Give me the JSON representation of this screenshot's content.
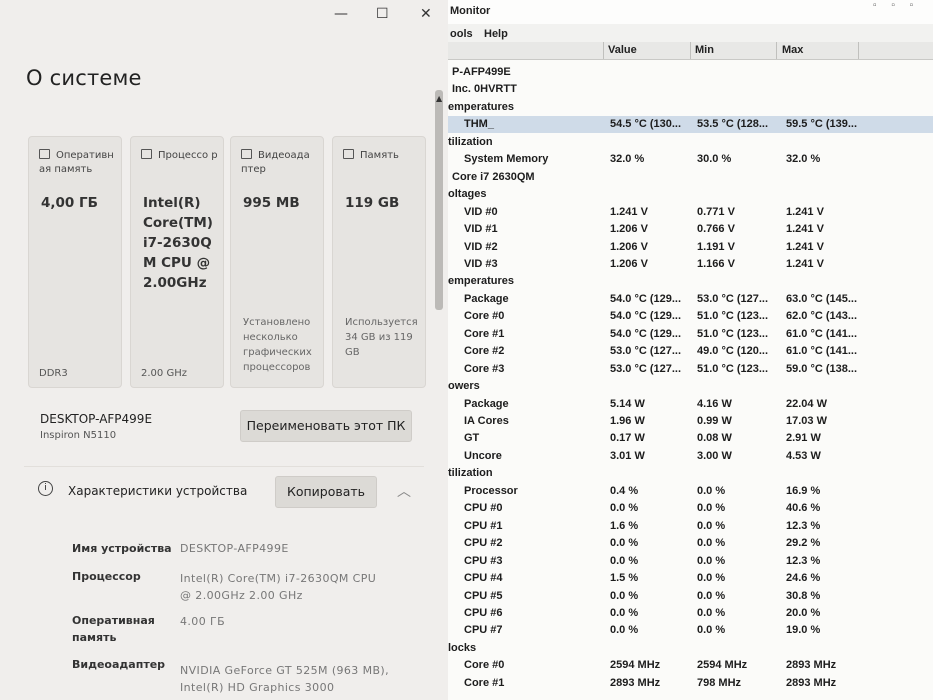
{
  "settings": {
    "window_controls": {
      "minimize": "—",
      "maximize": "☐",
      "close": "✕"
    },
    "title": "О системе",
    "tiles": [
      {
        "icon": "ram-icon",
        "header": "Оперативн ая память",
        "value": "4,00 ГБ",
        "note": "",
        "footer": "DDR3"
      },
      {
        "icon": "cpu-icon",
        "header": "Процессо р",
        "value": "Intel(R) Core(TM) i7-2630Q M CPU @ 2.00GHz",
        "note": "",
        "footer": "2.00 GHz"
      },
      {
        "icon": "gpu-icon",
        "header": "Видеоада птер",
        "value": "995 MB",
        "note": "Установлено несколько графических процессоров",
        "footer": ""
      },
      {
        "icon": "storage-icon",
        "header": "Память",
        "value": "119 GB",
        "note": "Используется 34 GB из 119 GB",
        "footer": ""
      }
    ],
    "device_name": "DESKTOP-AFP499E",
    "device_model": "Inspiron N5110",
    "rename_button": "Переименовать этот ПК",
    "device_specs": {
      "title": "Характеристики устройства",
      "copy_button": "Копировать",
      "rows": [
        {
          "key": "Имя устройства",
          "value": "DESKTOP-AFP499E"
        },
        {
          "key": "Процессор",
          "value": "Intel(R) Core(TM) i7-2630QM CPU @ 2.00GHz   2.00 GHz"
        },
        {
          "key": "Оперативная память",
          "value": "4.00 ГБ"
        },
        {
          "key": "Видеоадаптер",
          "value": "NVIDIA GeForce GT 525M (963 MB), Intel(R) HD Graphics 3000"
        }
      ]
    }
  },
  "hwmonitor": {
    "title": "Monitor",
    "menu": [
      "ools",
      "Help"
    ],
    "columns": [
      "Value",
      "Min",
      "Max"
    ],
    "rows": [
      {
        "kind": "dev",
        "label": "P-AFP499E"
      },
      {
        "kind": "dev",
        "label": "Inc. 0HVRTT"
      },
      {
        "kind": "sec",
        "label": "emperatures"
      },
      {
        "kind": "item",
        "label": "THM_",
        "value": "54.5 °C (130...",
        "min": "53.5 °C (128...",
        "max": "59.5 °C (139...",
        "selected": true
      },
      {
        "kind": "sec",
        "label": "tilization"
      },
      {
        "kind": "item",
        "label": "System Memory",
        "value": "32.0 %",
        "min": "30.0 %",
        "max": "32.0 %"
      },
      {
        "kind": "dev",
        "label": "Core i7 2630QM"
      },
      {
        "kind": "sec",
        "label": "oltages"
      },
      {
        "kind": "item",
        "label": "VID #0",
        "value": "1.241 V",
        "min": "0.771 V",
        "max": "1.241 V"
      },
      {
        "kind": "item",
        "label": "VID #1",
        "value": "1.206 V",
        "min": "0.766 V",
        "max": "1.241 V"
      },
      {
        "kind": "item",
        "label": "VID #2",
        "value": "1.206 V",
        "min": "1.191 V",
        "max": "1.241 V"
      },
      {
        "kind": "item",
        "label": "VID #3",
        "value": "1.206 V",
        "min": "1.166 V",
        "max": "1.241 V"
      },
      {
        "kind": "sec",
        "label": "emperatures"
      },
      {
        "kind": "item",
        "label": "Package",
        "value": "54.0 °C (129...",
        "min": "53.0 °C (127...",
        "max": "63.0 °C (145..."
      },
      {
        "kind": "item",
        "label": "Core #0",
        "value": "54.0 °C (129...",
        "min": "51.0 °C (123...",
        "max": "62.0 °C (143..."
      },
      {
        "kind": "item",
        "label": "Core #1",
        "value": "54.0 °C (129...",
        "min": "51.0 °C (123...",
        "max": "61.0 °C (141..."
      },
      {
        "kind": "item",
        "label": "Core #2",
        "value": "53.0 °C (127...",
        "min": "49.0 °C (120...",
        "max": "61.0 °C (141..."
      },
      {
        "kind": "item",
        "label": "Core #3",
        "value": "53.0 °C (127...",
        "min": "51.0 °C (123...",
        "max": "59.0 °C (138..."
      },
      {
        "kind": "sec",
        "label": "owers"
      },
      {
        "kind": "item",
        "label": "Package",
        "value": "5.14 W",
        "min": "4.16 W",
        "max": "22.04 W"
      },
      {
        "kind": "item",
        "label": "IA Cores",
        "value": "1.96 W",
        "min": "0.99 W",
        "max": "17.03 W"
      },
      {
        "kind": "item",
        "label": "GT",
        "value": "0.17 W",
        "min": "0.08 W",
        "max": "2.91 W"
      },
      {
        "kind": "item",
        "label": "Uncore",
        "value": "3.01 W",
        "min": "3.00 W",
        "max": "4.53 W"
      },
      {
        "kind": "sec",
        "label": "tilization"
      },
      {
        "kind": "item",
        "label": "Processor",
        "value": "0.4 %",
        "min": "0.0 %",
        "max": "16.9 %"
      },
      {
        "kind": "item",
        "label": "CPU #0",
        "value": "0.0 %",
        "min": "0.0 %",
        "max": "40.6 %"
      },
      {
        "kind": "item",
        "label": "CPU #1",
        "value": "1.6 %",
        "min": "0.0 %",
        "max": "12.3 %"
      },
      {
        "kind": "item",
        "label": "CPU #2",
        "value": "0.0 %",
        "min": "0.0 %",
        "max": "29.2 %"
      },
      {
        "kind": "item",
        "label": "CPU #3",
        "value": "0.0 %",
        "min": "0.0 %",
        "max": "12.3 %"
      },
      {
        "kind": "item",
        "label": "CPU #4",
        "value": "1.5 %",
        "min": "0.0 %",
        "max": "24.6 %"
      },
      {
        "kind": "item",
        "label": "CPU #5",
        "value": "0.0 %",
        "min": "0.0 %",
        "max": "30.8 %"
      },
      {
        "kind": "item",
        "label": "CPU #6",
        "value": "0.0 %",
        "min": "0.0 %",
        "max": "20.0 %"
      },
      {
        "kind": "item",
        "label": "CPU #7",
        "value": "0.0 %",
        "min": "0.0 %",
        "max": "19.0 %"
      },
      {
        "kind": "sec",
        "label": "locks"
      },
      {
        "kind": "item",
        "label": "Core #0",
        "value": "2594 MHz",
        "min": "2594 MHz",
        "max": "2893 MHz"
      },
      {
        "kind": "item",
        "label": "Core #1",
        "value": "2893 MHz",
        "min": "798 MHz",
        "max": "2893 MHz"
      }
    ]
  }
}
